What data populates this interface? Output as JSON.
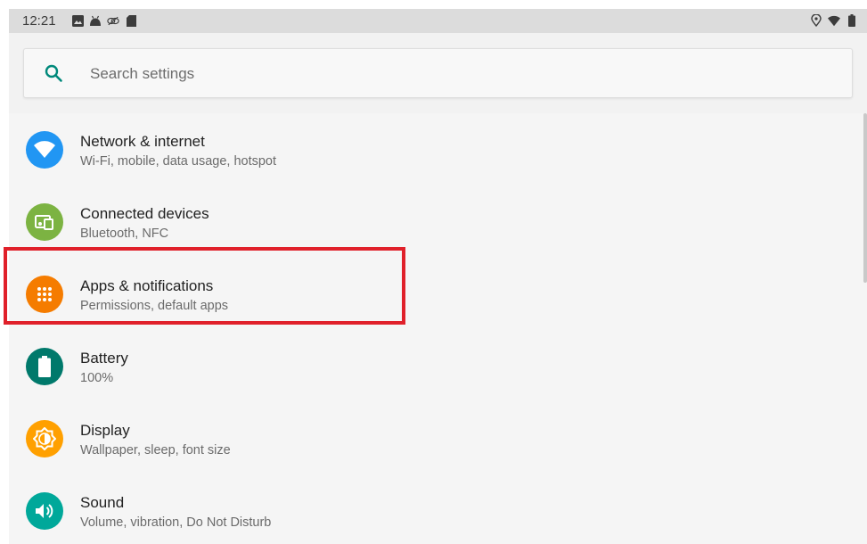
{
  "statusbar": {
    "time": "12:21",
    "left_icons": [
      "image-icon",
      "android-icon",
      "sync-icon",
      "sd-card-icon"
    ],
    "right_icons": [
      "location-icon",
      "wifi-icon",
      "battery-icon"
    ]
  },
  "search": {
    "placeholder": "Search settings"
  },
  "items": [
    {
      "title": "Network & internet",
      "subtitle": "Wi-Fi, mobile, data usage, hotspot",
      "icon": "wifi-icon",
      "color": "#2196f3"
    },
    {
      "title": "Connected devices",
      "subtitle": "Bluetooth, NFC",
      "icon": "devices-icon",
      "color": "#7cb342"
    },
    {
      "title": "Apps & notifications",
      "subtitle": "Permissions, default apps",
      "icon": "apps-grid-icon",
      "color": "#f57c00"
    },
    {
      "title": "Battery",
      "subtitle": "100%",
      "icon": "battery-icon",
      "color": "#00796b"
    },
    {
      "title": "Display",
      "subtitle": "Wallpaper, sleep, font size",
      "icon": "brightness-icon",
      "color": "#ffa000"
    },
    {
      "title": "Sound",
      "subtitle": "Volume, vibration, Do Not Disturb",
      "icon": "volume-icon",
      "color": "#00a89a"
    }
  ],
  "colors": {
    "highlight": "#e0202a",
    "accent": "#00897b"
  }
}
